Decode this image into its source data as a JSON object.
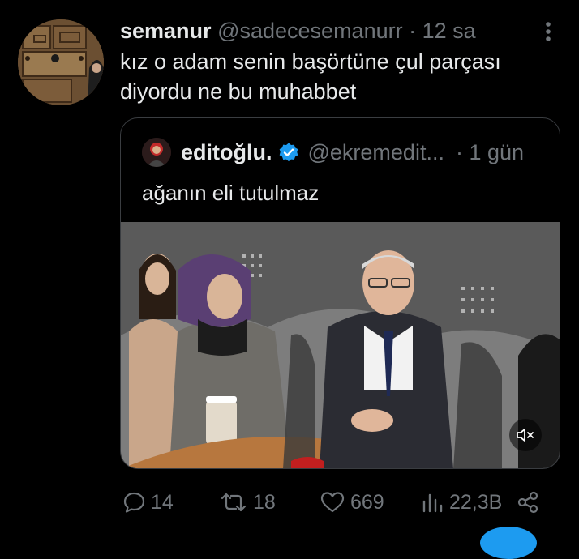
{
  "tweet": {
    "display_name": "semanur",
    "handle": "@sadecesemanurr",
    "separator": "·",
    "time": "12 sa",
    "text": "kız o adam senin başörtüne çul parçası diyordu ne bu muhabbet",
    "more_icon": "more-vertical-icon"
  },
  "quote": {
    "display_name": "editoğlu.",
    "handle": "@ekremedit...",
    "separator": "·",
    "time": "1 gün",
    "text": "ağanın eli tutulmaz",
    "verified_icon": "verified-badge-icon",
    "media_icon": "mute-icon"
  },
  "actions": {
    "reply_count": "14",
    "retweet_count": "18",
    "like_count": "669",
    "views_count": "22,3B"
  },
  "colors": {
    "background": "#000000",
    "text": "#e7e9ea",
    "secondary": "#71767b",
    "accent": "#1d9bf0"
  }
}
